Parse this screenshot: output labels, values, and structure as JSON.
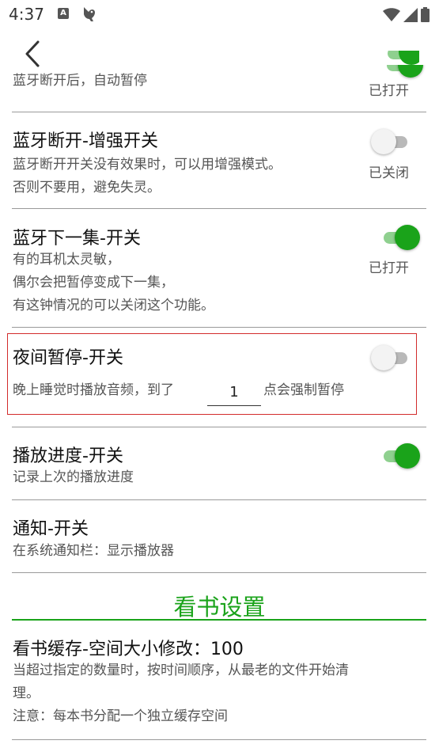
{
  "status_bar": {
    "time": "4:37",
    "a_icon_label": "A"
  },
  "rows": {
    "bt_disconnect_auto_pause": {
      "desc": "蓝牙断开后，自动暂停",
      "state": "已打开"
    },
    "bt_disconnect_enhance": {
      "title": "蓝牙断开-增强开关",
      "desc1": "蓝牙断开开关没有效果时，可以用增强模式。",
      "desc2": "否则不要用，避免失灵。",
      "state": "已关闭"
    },
    "bt_next_episode": {
      "title": "蓝牙下一集-开关",
      "desc1": "有的耳机太灵敏，",
      "desc2": "偶尔会把暂停变成下一集，",
      "desc3": "有这钟情况的可以关闭这个功能。",
      "state": "已打开"
    },
    "night_pause": {
      "title": "夜间暂停-开关",
      "desc_before": "晚上睡觉时播放音频，到了",
      "hour_value": "1",
      "desc_after": "点会强制暂停"
    },
    "playback_progress": {
      "title": "播放进度-开关",
      "desc": "记录上次的播放进度"
    },
    "notification": {
      "title": "通知-开关",
      "desc": "在系统通知栏：显示播放器"
    }
  },
  "section_reading": {
    "header": "看书设置"
  },
  "book_cache": {
    "title": "看书缓存-空间大小修改：100",
    "desc1": "当超过指定的数量时，按时间顺序，从最老的文件开始清",
    "desc2": "理。",
    "desc3": "注意：每本书分配一个独立缓存空间"
  },
  "colors": {
    "accent_green": "#1aa31a",
    "highlight_red": "#d22b2b"
  },
  "switch_states": {
    "bt_disconnect_auto_pause": "on",
    "bt_disconnect_enhance": "off",
    "bt_next_episode": "on",
    "night_pause": "off",
    "playback_progress": "on"
  }
}
